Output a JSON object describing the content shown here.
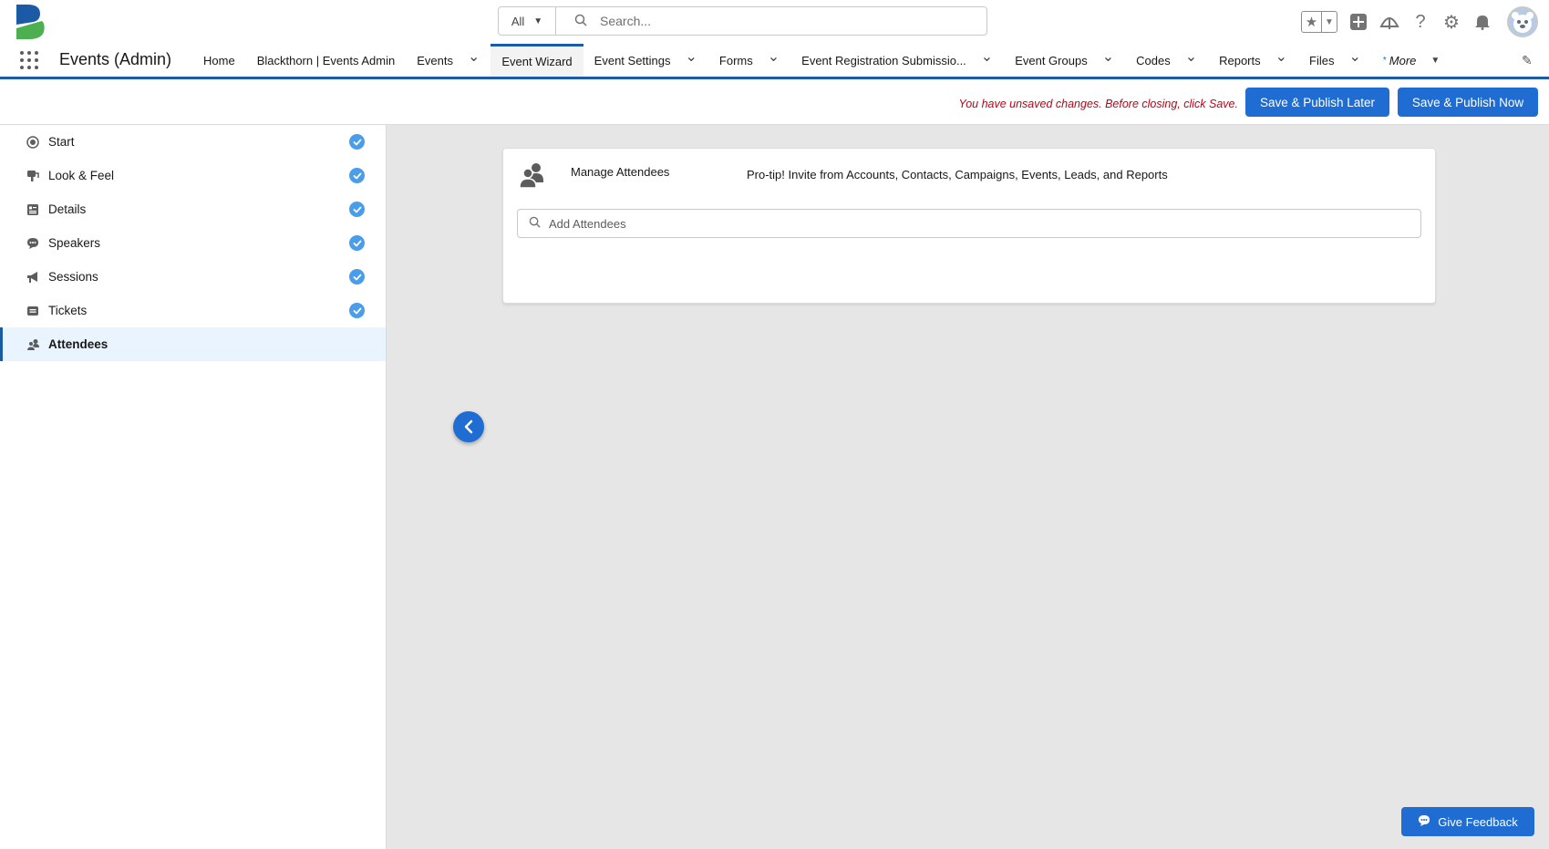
{
  "header": {
    "search_scope": "All",
    "search_placeholder": "Search..."
  },
  "nav": {
    "app_name": "Events (Admin)",
    "tabs": [
      {
        "label": "Home",
        "dropdown": false
      },
      {
        "label": "Blackthorn | Events Admin",
        "dropdown": false
      },
      {
        "label": "Events",
        "dropdown": true
      },
      {
        "label": "Event Wizard",
        "dropdown": false,
        "active": true
      },
      {
        "label": "Event Settings",
        "dropdown": true
      },
      {
        "label": "Forms",
        "dropdown": true
      },
      {
        "label": "Event Registration Submissio...",
        "dropdown": true
      },
      {
        "label": "Event Groups",
        "dropdown": true
      },
      {
        "label": "Codes",
        "dropdown": true
      },
      {
        "label": "Reports",
        "dropdown": true
      },
      {
        "label": "Files",
        "dropdown": true
      }
    ],
    "more_label": "More",
    "more_marker": "*"
  },
  "actions": {
    "unsaved_message": "You have unsaved changes. Before closing, click Save.",
    "publish_later": "Save & Publish Later",
    "publish_now": "Save & Publish Now"
  },
  "sidebar": {
    "steps": [
      {
        "label": "Start",
        "icon": "target-icon",
        "complete": true
      },
      {
        "label": "Look & Feel",
        "icon": "paint-icon",
        "complete": true
      },
      {
        "label": "Details",
        "icon": "details-icon",
        "complete": true
      },
      {
        "label": "Speakers",
        "icon": "chat-icon",
        "complete": true
      },
      {
        "label": "Sessions",
        "icon": "megaphone-icon",
        "complete": true
      },
      {
        "label": "Tickets",
        "icon": "ticket-icon",
        "complete": true
      },
      {
        "label": "Attendees",
        "icon": "people-icon",
        "complete": false,
        "active": true
      }
    ]
  },
  "main": {
    "card_title": "Manage Attendees",
    "card_tip": "Pro-tip! Invite from Accounts, Contacts, Campaigns, Events, Leads, and Reports",
    "search_placeholder": "Add Attendees",
    "feedback_label": "Give Feedback"
  },
  "colors": {
    "brand_blue": "#1f6cd2",
    "nav_accent": "#1b5ba6",
    "check_blue": "#4a9de8",
    "error_red": "#ba0517"
  }
}
